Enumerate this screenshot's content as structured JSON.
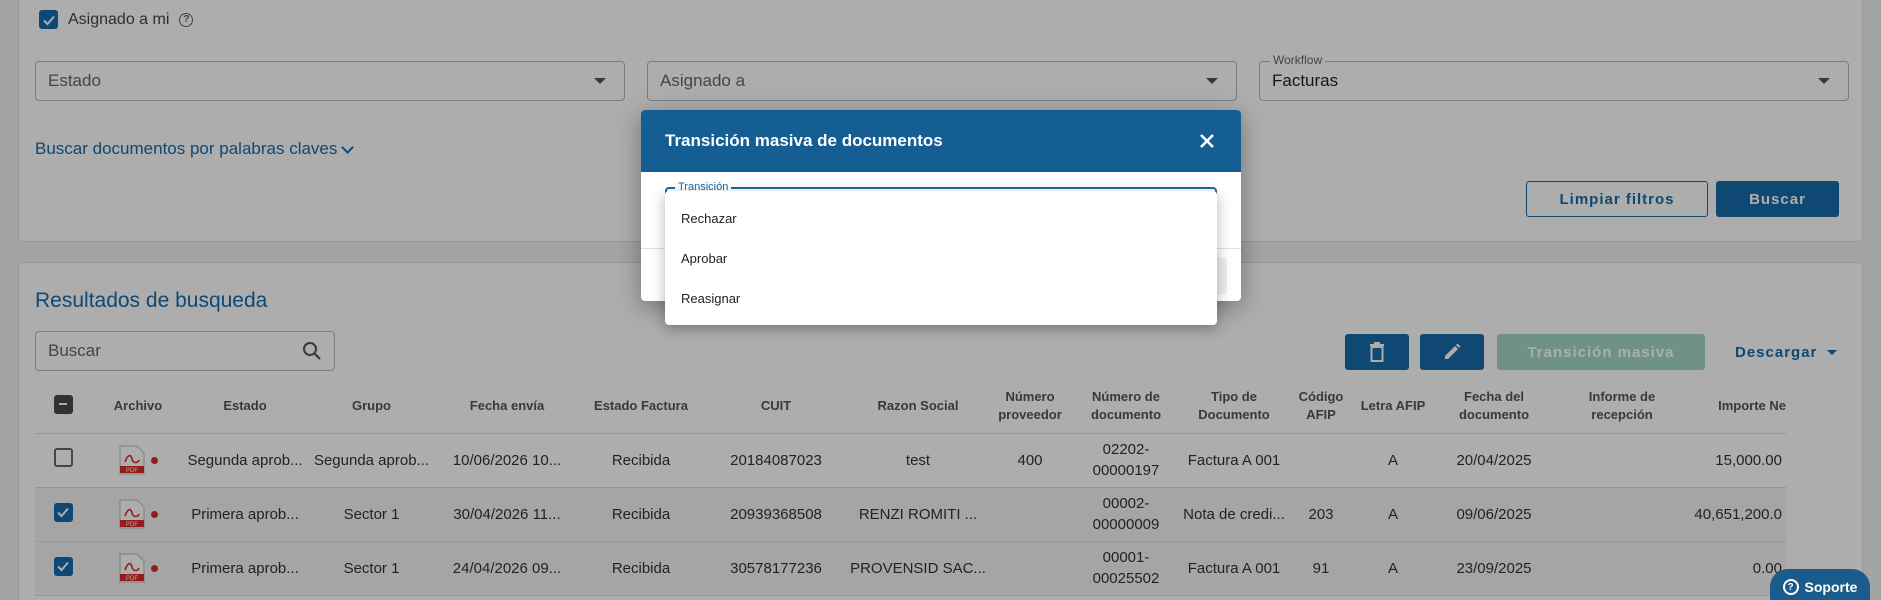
{
  "filters": {
    "assigned_to_me": {
      "label": "Asignado a mi",
      "checked": true
    },
    "estado": {
      "placeholder": "Estado"
    },
    "asignado_a": {
      "placeholder": "Asignado a"
    },
    "workflow": {
      "label": "Workflow",
      "value": "Facturas"
    },
    "keyword_link": "Buscar documentos por palabras claves",
    "clear_label": "Limpiar filtros",
    "search_label": "Buscar"
  },
  "results": {
    "title": "Resultados de busqueda",
    "search_placeholder": "Buscar",
    "mass_transition_label": "Transición masiva",
    "download_label": "Descargar",
    "columns": [
      "Archivo",
      "Estado",
      "Grupo",
      "Fecha envía",
      "Estado Factura",
      "CUIT",
      "Razon Social",
      "Número proveedor",
      "Número de documento",
      "Tipo de Documento",
      "Código AFIP",
      "Letra AFIP",
      "Fecha del documento",
      "Informe de recepción",
      "Importe Ne"
    ],
    "rows": [
      {
        "checked": false,
        "estado": "Segunda aprob...",
        "grupo": "Segunda aprob...",
        "fecha_envia": "10/06/2026 10...",
        "estado_factura": "Recibida",
        "cuit": "20184087023",
        "razon_social": "test",
        "numero_proveedor": "400",
        "numero_documento": "02202-00000197",
        "tipo_documento": "Factura A 001",
        "codigo_afip": "",
        "letra_afip": "A",
        "fecha_documento": "20/04/2025",
        "informe_recepcion": "",
        "importe_neto": "15,000.00"
      },
      {
        "checked": true,
        "estado": "Primera aprob...",
        "grupo": "Sector 1",
        "fecha_envia": "30/04/2026 11...",
        "estado_factura": "Recibida",
        "cuit": "20939368508",
        "razon_social": "RENZI ROMITI ...",
        "numero_proveedor": "",
        "numero_documento": "00002-00000009",
        "tipo_documento": "Nota de credi...",
        "codigo_afip": "203",
        "letra_afip": "A",
        "fecha_documento": "09/06/2025",
        "informe_recepcion": "",
        "importe_neto": "40,651,200.0"
      },
      {
        "checked": true,
        "estado": "Primera aprob...",
        "grupo": "Sector 1",
        "fecha_envia": "24/04/2026 09...",
        "estado_factura": "Recibida",
        "cuit": "30578177236",
        "razon_social": "PROVENSID SAC...",
        "numero_proveedor": "",
        "numero_documento": "00001-00025502",
        "tipo_documento": "Factura A 001",
        "codigo_afip": "91",
        "letra_afip": "A",
        "fecha_documento": "23/09/2025",
        "informe_recepcion": "",
        "importe_neto": "0.00"
      }
    ]
  },
  "modal": {
    "title": "Transición masiva de documentos",
    "field_label": "Transición",
    "options": [
      "Rechazar",
      "Aprobar",
      "Reasignar"
    ]
  },
  "support_label": "Soporte",
  "colors": {
    "primary": "#176ba8",
    "header": "#145e94",
    "disabled_green": "#a2d9c3",
    "pdf_red": "#d62b2b"
  }
}
